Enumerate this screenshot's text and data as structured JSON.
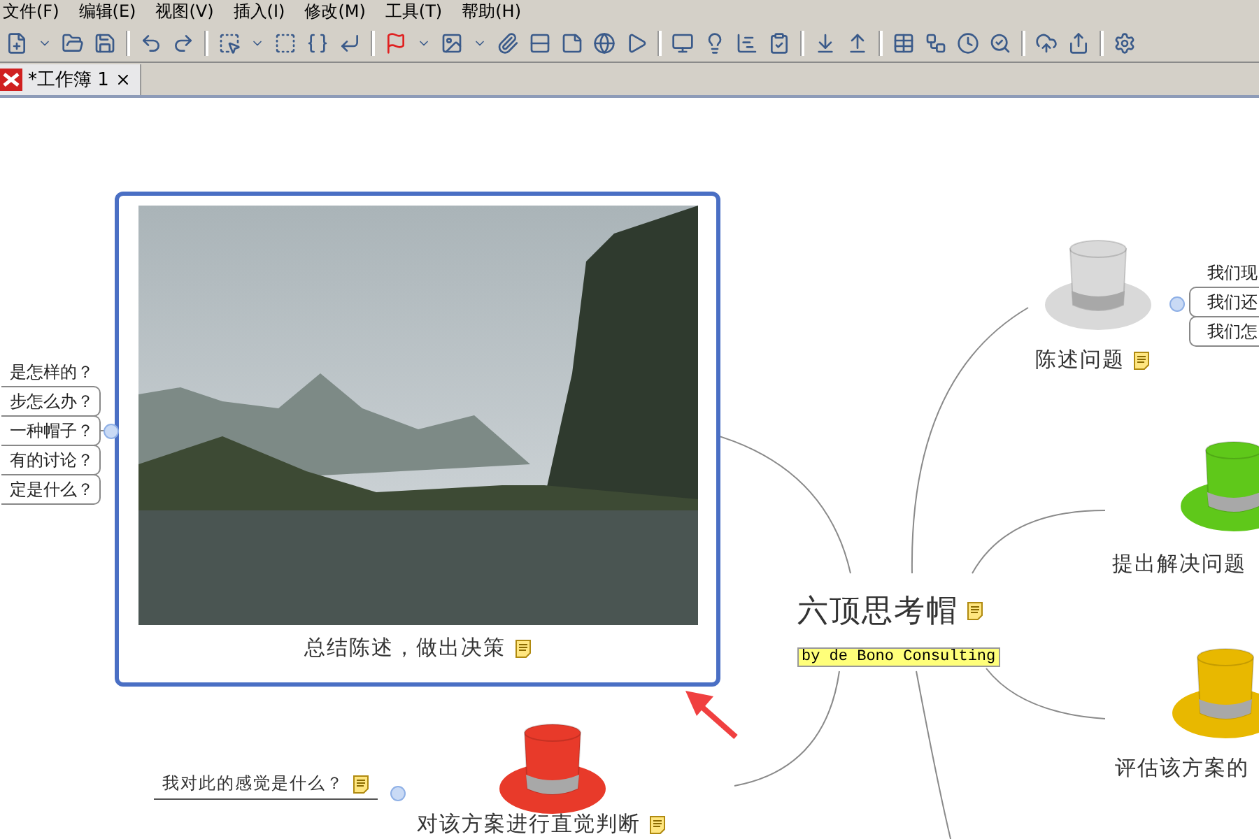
{
  "menu_bar": [
    "文件(F)",
    "编辑(E)",
    "视图(V)",
    "插入(I)",
    "修改(M)",
    "工具(T)",
    "帮助(H)"
  ],
  "tabs": [
    {
      "label": "*工作簿 1",
      "selected": true
    }
  ],
  "map": {
    "central": {
      "title": "六顶思考帽",
      "note": true,
      "subtitle": "by de Bono Consulting"
    },
    "topics": [
      {
        "kind": "photo",
        "label": "总结陈述，做出决策",
        "note": true,
        "selected": true,
        "children": [
          {
            "label": "是怎样的？"
          },
          {
            "label": "步怎么办？"
          },
          {
            "label": "一种帽子？"
          },
          {
            "label": "有的讨论？"
          },
          {
            "label": "定是什么？"
          }
        ]
      },
      {
        "kind": "hat",
        "color": "#d9d9d9",
        "label": "陈述问题",
        "note": true,
        "selected": false,
        "children": [
          {
            "label": "我们现"
          },
          {
            "label": "我们还"
          },
          {
            "label": "我们怎"
          }
        ]
      },
      {
        "kind": "hat",
        "color": "#5fc81a",
        "label": "提出解决问题",
        "note": false,
        "selected": false
      },
      {
        "kind": "hat",
        "color": "#e8b800",
        "label": "评估该方案的",
        "note": false,
        "selected": false
      },
      {
        "kind": "hat",
        "color": "#e83a2a",
        "label": "对该方案进行直觉判断",
        "note": true,
        "selected": false,
        "children": [
          {
            "label": "我对此的感觉是什么？",
            "note": true
          }
        ]
      }
    ]
  }
}
